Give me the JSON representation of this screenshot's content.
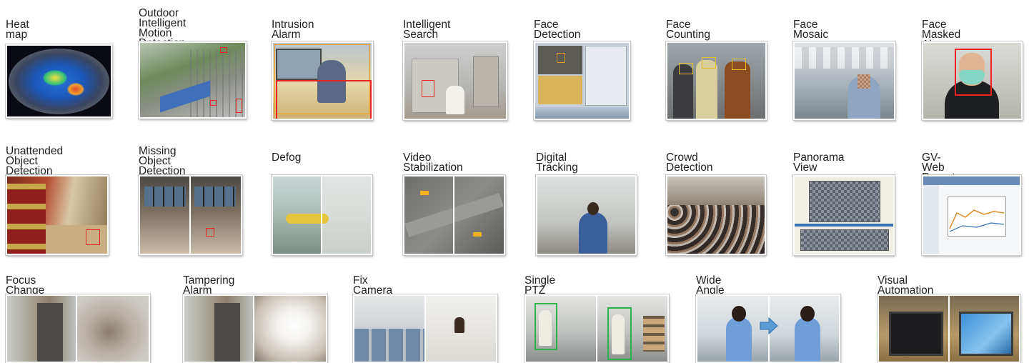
{
  "row1": [
    {
      "label": "Heat map"
    },
    {
      "label": "Outdoor Intelligent\nMotion Detection"
    },
    {
      "label": "Intrusion Alarm"
    },
    {
      "label": "Intelligent Search"
    },
    {
      "label": "Face Detection"
    },
    {
      "label": "Face Counting"
    },
    {
      "label": "Face Mosaic"
    },
    {
      "label": "Face Masked Alarm"
    }
  ],
  "row2": [
    {
      "label": "Unattended Object\nDetection"
    },
    {
      "label": "Missing Object\nDetection"
    },
    {
      "label": "Defog"
    },
    {
      "label": "Video Stabilization"
    },
    {
      "label": "Digital Tracking"
    },
    {
      "label": "Crowd Detection"
    },
    {
      "label": "Panorama View"
    },
    {
      "label": "GV-Web Report"
    }
  ],
  "row3": [
    {
      "label": "Focus Change Alarm"
    },
    {
      "label": "Tampering Alarm"
    },
    {
      "label": "Fix Camera + PTZ Tracking"
    },
    {
      "label": "Single PTZ Tracking"
    },
    {
      "label": "Wide Angle Lens Dewarping"
    },
    {
      "label": "Visual Automation"
    }
  ]
}
